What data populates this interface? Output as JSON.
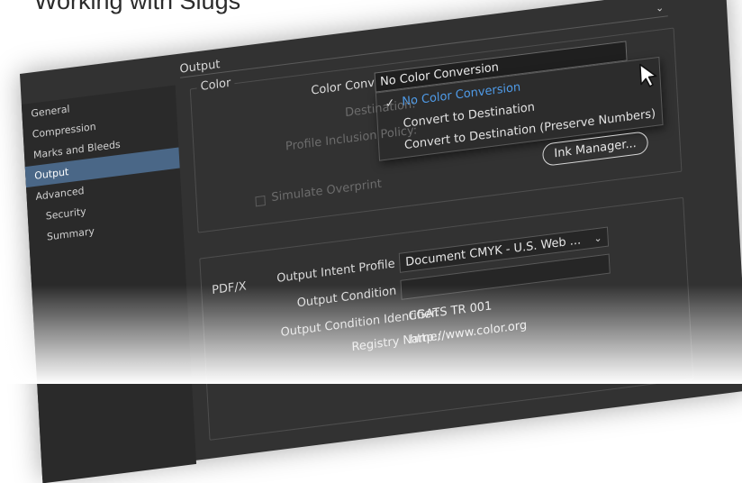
{
  "caption": "Working with Slugs",
  "sidebar": {
    "items": [
      {
        "label": "General",
        "active": false,
        "indent": false
      },
      {
        "label": "Compression",
        "active": false,
        "indent": false
      },
      {
        "label": "Marks and Bleeds",
        "active": false,
        "indent": false
      },
      {
        "label": "Output",
        "active": true,
        "indent": false
      },
      {
        "label": "Advanced",
        "active": false,
        "indent": false
      },
      {
        "label": "Security",
        "active": false,
        "indent": true
      },
      {
        "label": "Summary",
        "active": false,
        "indent": true
      }
    ]
  },
  "main": {
    "section_title": "Output",
    "color_group": {
      "title": "Color",
      "color_conversion_label": "Color Conversion:",
      "color_conversion_value": "No Color Conversion",
      "destination_label": "Destination:",
      "profile_policy_label": "Profile Inclusion Policy:",
      "simulate_overprint_label": "Simulate Overprint",
      "ink_manager_label": "Ink Manager...",
      "dropdown_options": [
        {
          "label": "No Color Conversion",
          "selected": true
        },
        {
          "label": "Convert to Destination",
          "selected": false
        },
        {
          "label": "Convert to Destination (Preserve Numbers)",
          "selected": false
        }
      ]
    },
    "pdfx_group": {
      "title": "PDF/X",
      "output_intent_label": "Output Intent Profile Name:",
      "output_intent_value": "Document CMYK - U.S. Web ...",
      "output_condition_label": "Output Condition Name:",
      "output_condition_value": "",
      "condition_identifier_label": "Output Condition Identifier:",
      "condition_identifier_value": "CGATS TR 001",
      "registry_label": "Registry Name:",
      "registry_value": "http://www.color.org"
    }
  },
  "colors": {
    "dialog_bg": "#323232",
    "sidebar_bg": "#2a2a2a",
    "active_item": "#4a6787",
    "selected_option": "#4f9be8"
  }
}
